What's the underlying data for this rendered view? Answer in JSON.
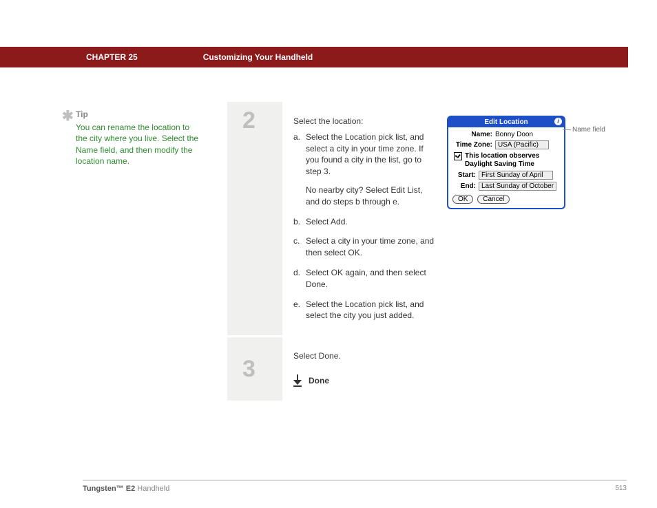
{
  "header": {
    "chapter": "CHAPTER 25",
    "title": "Customizing Your Handheld"
  },
  "tip": {
    "heading": "Tip",
    "body": "You can rename the location to the city where you live. Select the Name field, and then modify the location name."
  },
  "step2": {
    "num": "2",
    "intro": "Select the location:",
    "a": "Select the Location pick list, and select a city in your time zone. If you found a city in the list, go to step 3.",
    "a_note": "No nearby city? Select Edit List, and do steps b through e.",
    "b": "Select Add.",
    "c": "Select a city in your time zone, and then select OK.",
    "d": "Select OK again, and then select Done.",
    "e": "Select the Location pick list, and select the city you just added."
  },
  "step3": {
    "num": "3",
    "text": "Select Done.",
    "done": "Done"
  },
  "dialog": {
    "title": "Edit Location",
    "name_label": "Name:",
    "name_value": "Bonny Doon",
    "tz_label": "Time Zone:",
    "tz_value": "USA (Pacific)",
    "dst_text": "This location observes Daylight Saving Time",
    "start_label": "Start:",
    "start_value": "First Sunday of April",
    "end_label": "End:",
    "end_value": "Last Sunday of October",
    "ok": "OK",
    "cancel": "Cancel",
    "callout": "Name field"
  },
  "sub_letters": {
    "a": "a.",
    "b": "b.",
    "c": "c.",
    "d": "d.",
    "e": "e."
  },
  "footer": {
    "product_bold": "Tungsten™ E2",
    "product_rest": " Handheld",
    "page": "513"
  }
}
